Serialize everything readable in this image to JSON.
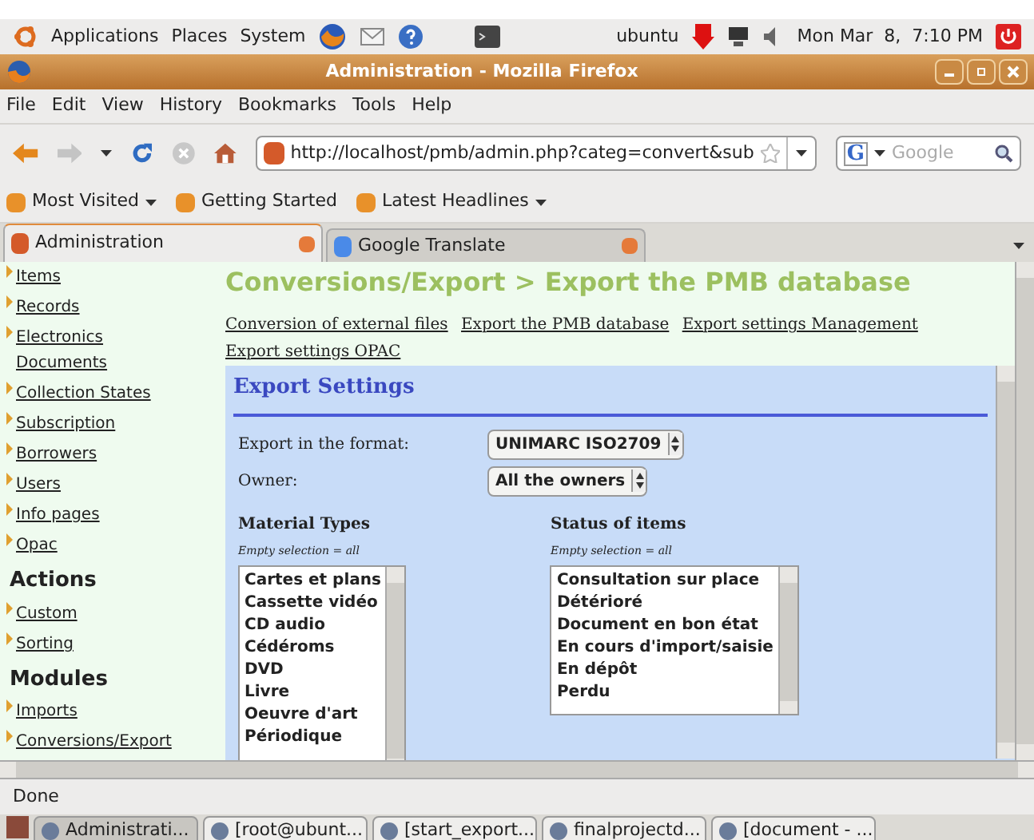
{
  "top_panel": {
    "menus": [
      "Applications",
      "Places",
      "System"
    ],
    "user": "ubuntu",
    "clock": "Mon Mar  8,  7:10 PM"
  },
  "window": {
    "title": "Administration - Mozilla Firefox"
  },
  "menu_bar": [
    "File",
    "Edit",
    "View",
    "History",
    "Bookmarks",
    "Tools",
    "Help"
  ],
  "address_bar": {
    "value": "http://localhost/pmb/admin.php?categ=convert&sub"
  },
  "search": {
    "engine": "G",
    "placeholder": "Google"
  },
  "bookmarks": [
    {
      "label": "Most Visited",
      "dropdown": true
    },
    {
      "label": "Getting Started",
      "dropdown": false
    },
    {
      "label": "Latest Headlines",
      "dropdown": true
    }
  ],
  "tabs": [
    {
      "label": "Administration",
      "selected": true
    },
    {
      "label": "Google Translate",
      "selected": false
    }
  ],
  "sidebar": {
    "items": [
      {
        "kind": "link",
        "label": "Items"
      },
      {
        "kind": "link",
        "label": "Records"
      },
      {
        "kind": "link",
        "label": "Electronics Documents"
      },
      {
        "kind": "link",
        "label": "Collection States"
      },
      {
        "kind": "link",
        "label": "Subscription"
      },
      {
        "kind": "link",
        "label": "Borrowers"
      },
      {
        "kind": "link",
        "label": "Users"
      },
      {
        "kind": "link",
        "label": "Info pages"
      },
      {
        "kind": "link",
        "label": "Opac"
      },
      {
        "kind": "heading",
        "label": "Actions"
      },
      {
        "kind": "link",
        "label": "Custom"
      },
      {
        "kind": "link",
        "label": "Sorting"
      },
      {
        "kind": "heading",
        "label": "Modules"
      },
      {
        "kind": "link",
        "label": "Imports"
      },
      {
        "kind": "link",
        "label": "Conversions/Export"
      }
    ]
  },
  "page": {
    "heading": "Conversions/Export > Export the PMB database",
    "links": [
      "Conversion of external files",
      "Export the PMB database",
      "Export settings Management",
      "Export settings OPAC"
    ],
    "panel_title": "Export Settings",
    "fields": [
      {
        "label": "Export in the format:",
        "value": "UNIMARC ISO2709"
      },
      {
        "label": "Owner:",
        "value": "All the owners"
      }
    ],
    "lists": [
      {
        "title": "Material Types",
        "hint": "Empty selection = all",
        "options": [
          "Cartes et plans",
          "Cassette vidéo",
          "CD audio",
          "Cédéroms",
          "DVD",
          "Livre",
          "Oeuvre d'art",
          "Périodique"
        ]
      },
      {
        "title": "Status of items",
        "hint": "Empty selection = all",
        "options": [
          "Consultation sur place",
          "Détérioré",
          "Document en bon état",
          "En cours d'import/saisie",
          "En dépôt",
          "Perdu"
        ]
      }
    ]
  },
  "status_bar": "Done",
  "taskbar": [
    {
      "label": "Administrati...",
      "selected": true
    },
    {
      "label": "[root@ubunt...",
      "selected": false
    },
    {
      "label": "[start_export...",
      "selected": false
    },
    {
      "label": "finalprojectd...",
      "selected": false
    },
    {
      "label": "[document - ...",
      "selected": false
    }
  ]
}
